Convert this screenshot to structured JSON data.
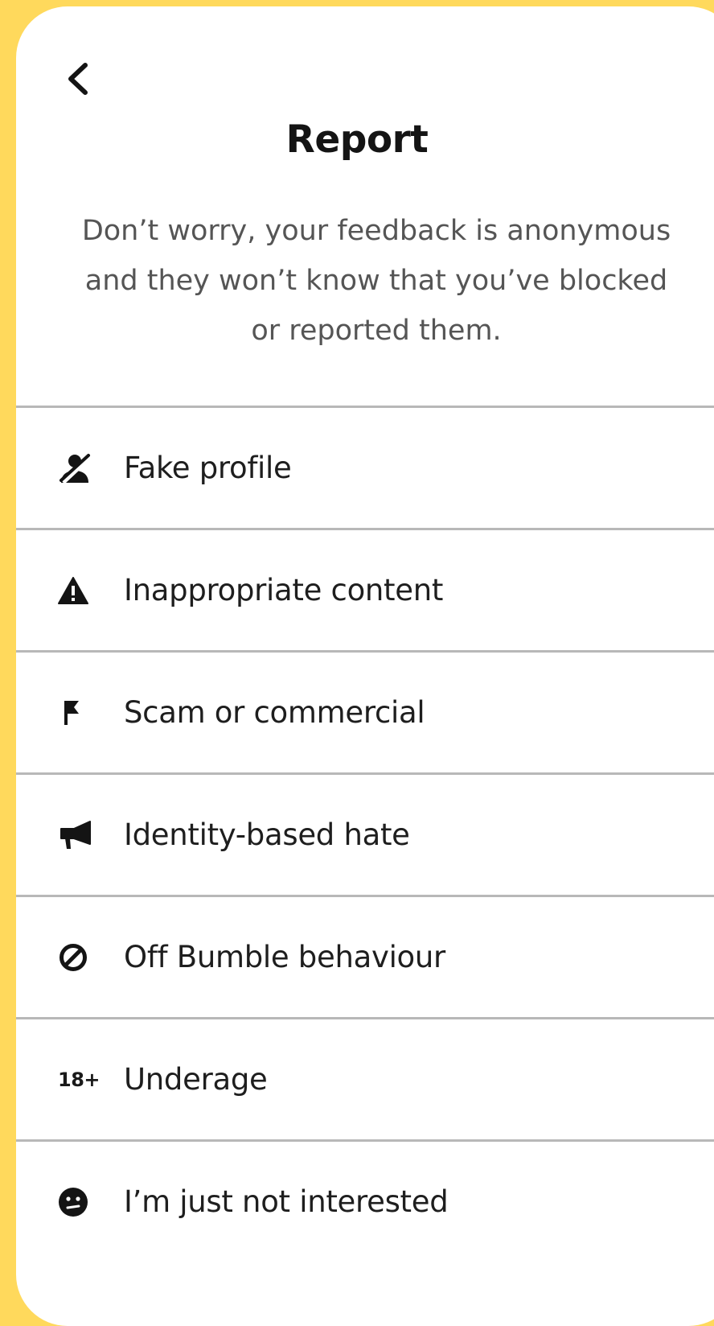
{
  "header": {
    "title": "Report",
    "subtitle": "Don’t worry, your feedback is anonymous and they won’t know that you’ve blocked or reported them."
  },
  "icons": {
    "back": "chevron-left-icon"
  },
  "options": [
    {
      "label": "Fake profile",
      "icon": "person-slash-icon"
    },
    {
      "label": "Inappropriate content",
      "icon": "warning-triangle-icon"
    },
    {
      "label": "Scam or commercial",
      "icon": "flag-icon"
    },
    {
      "label": "Identity-based hate",
      "icon": "megaphone-icon"
    },
    {
      "label": "Off Bumble behaviour",
      "icon": "prohibited-icon"
    },
    {
      "label": "Underage",
      "icon": "age-18-plus-icon",
      "icon_text": "18+"
    },
    {
      "label": "I’m just not interested",
      "icon": "meh-face-icon"
    }
  ],
  "colors": {
    "background": "#FFD95C",
    "card": "#FFFFFF",
    "divider": "#B8B8B8",
    "text": "#1E1E1E"
  }
}
